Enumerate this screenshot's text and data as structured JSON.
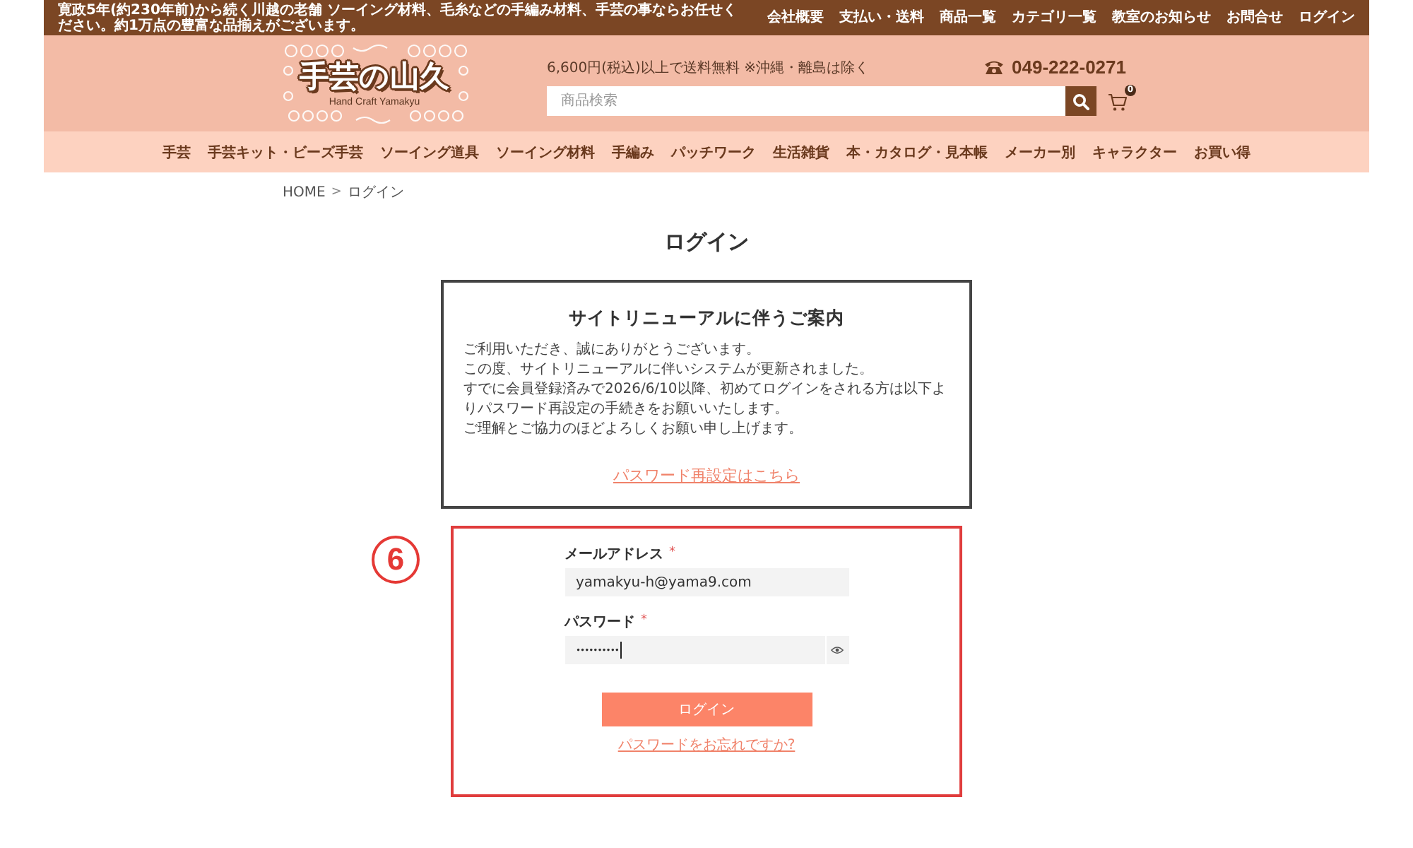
{
  "top_bar": {
    "message": "寛政5年(約230年前)から続く川越の老舗 ソーイング材料、毛糸などの手編み材料、手芸の事ならお任せください。約1万点の豊富な品揃えがございます。",
    "links": [
      "会社概要",
      "支払い・送料",
      "商品一覧",
      "カテゴリ一覧",
      "教室のお知らせ",
      "お問合せ",
      "ログイン"
    ]
  },
  "header": {
    "logo": {
      "title": "手芸の山久",
      "subtitle": "Hand Craft Yamakyu"
    },
    "shipping_note": "6,600円(税込)以上で送料無料 ※沖縄・離島は除く",
    "phone": "049-222-0271",
    "search": {
      "placeholder": "商品検索"
    },
    "cart": {
      "count": "0"
    }
  },
  "nav": {
    "items": [
      "手芸",
      "手芸キット・ビーズ手芸",
      "ソーイング道具",
      "ソーイング材料",
      "手編み",
      "パッチワーク",
      "生活雑貨",
      "本・カタログ・見本帳",
      "メーカー別",
      "キャラクター",
      "お買い得"
    ]
  },
  "breadcrumb": {
    "items": [
      "HOME",
      "ログイン"
    ],
    "separator": ">"
  },
  "page_title": "ログイン",
  "notice": {
    "title": "サイトリニューアルに伴うご案内",
    "paragraphs": [
      "ご利用いただき、誠にありがとうございます。",
      "この度、サイトリニューアルに伴いシステムが更新されました。",
      "すでに会員登録済みで2026/6/10以降、初めてログインをされる方は以下よりパスワード再設定の手続きをお願いいたします。",
      "ご理解とご協力のほどよろしくお願い申し上げます。"
    ],
    "link": "パスワード再設定はこちら"
  },
  "annotation": {
    "number": "6"
  },
  "login_form": {
    "fields": [
      {
        "kind": "text",
        "label": "メールアドレス",
        "required_mark": "*",
        "value": "yamakyu-h@yama9.com",
        "focused": false
      },
      {
        "kind": "password",
        "label": "パスワード",
        "required_mark": "*",
        "value": "••••••••••",
        "focused": true
      }
    ],
    "submit": "ログイン",
    "forgot_link": "パスワードをお忘れですか?"
  }
}
